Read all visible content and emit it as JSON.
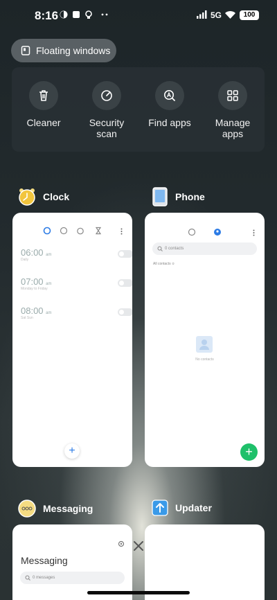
{
  "status_bar": {
    "time": "8:16",
    "network": "5G",
    "battery": "100"
  },
  "floating_windows": {
    "label": "Floating windows"
  },
  "tools": [
    {
      "icon": "trash-icon",
      "label": "Cleaner"
    },
    {
      "icon": "security-scan-icon",
      "label": "Security scan"
    },
    {
      "icon": "find-apps-icon",
      "label": "Find apps"
    },
    {
      "icon": "manage-apps-icon",
      "label": "Manage apps"
    }
  ],
  "apps": {
    "clock": {
      "name": "Clock",
      "alarms": [
        {
          "time": "06:00",
          "ampm": "am",
          "repeat": "Daily"
        },
        {
          "time": "07:00",
          "ampm": "am",
          "repeat": "Monday to Friday"
        },
        {
          "time": "08:00",
          "ampm": "am",
          "repeat": "Sat Sun"
        }
      ],
      "fab": "+"
    },
    "phone": {
      "name": "Phone",
      "search_placeholder": "0 contacts",
      "filter": "All contacts",
      "empty_text": "No contacts",
      "fab": "+"
    },
    "messaging": {
      "name": "Messaging",
      "title": "Messaging",
      "search_placeholder": "0 messages"
    },
    "updater": {
      "name": "Updater"
    }
  },
  "colors": {
    "accent_blue": "#2c7be5",
    "accent_green": "#1fc06a",
    "clock_yellow": "#f2c53d"
  }
}
